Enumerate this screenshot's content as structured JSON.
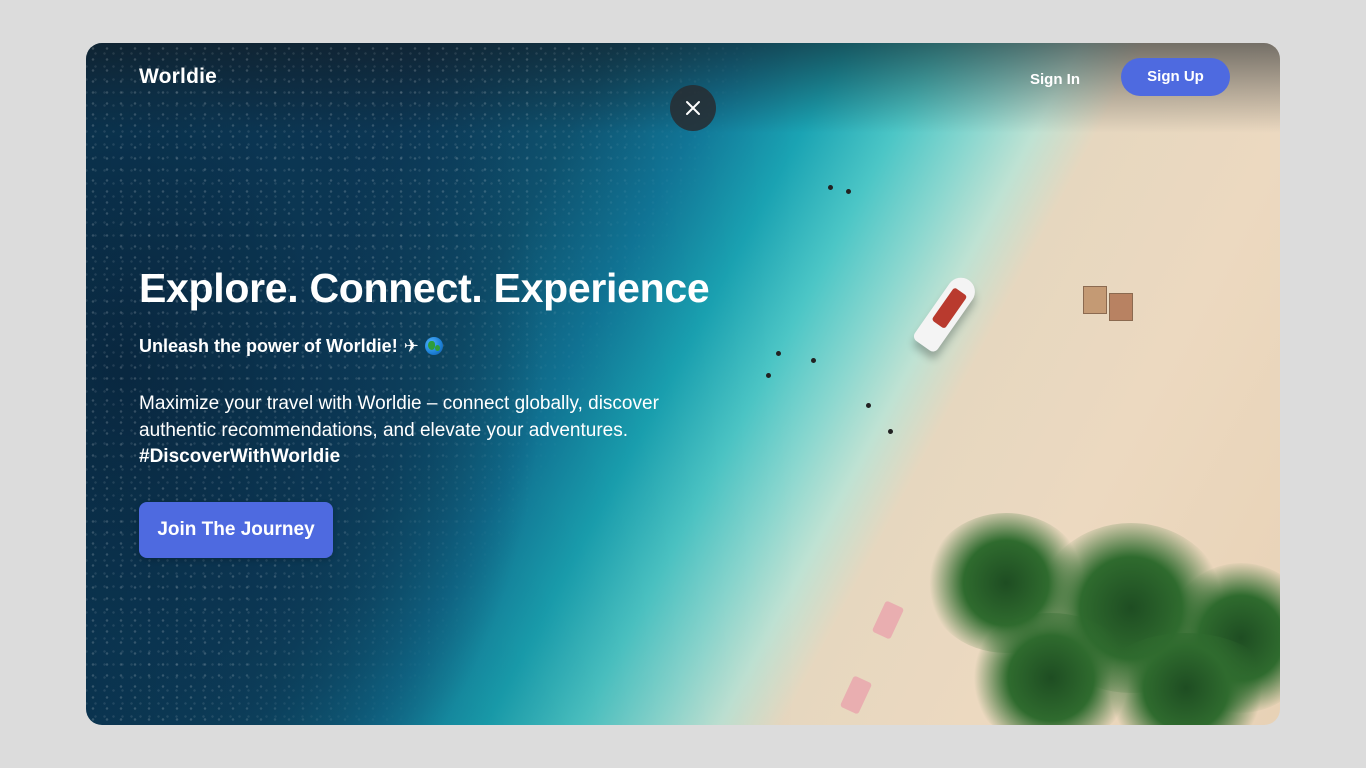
{
  "brand": {
    "name": "Worldie"
  },
  "header": {
    "signin_label": "Sign In",
    "signup_label": "Sign Up"
  },
  "close_icon": "close-icon",
  "hero": {
    "title": "Explore. Connect. Experience",
    "subtitle": "Unleash the power of Worldie!",
    "subtitle_plane": "✈",
    "subtitle_globe_icon": "globe-emoji-icon",
    "description": "Maximize your travel with Worldie – connect globally, discover authentic recommendations, and elevate your adventures.",
    "hashtag": "#DiscoverWithWorldie",
    "cta_label": "Join The Journey"
  },
  "colors": {
    "accent": "#4e6ae0",
    "page_background": "#dcdcdc",
    "close_button_bg": "#2c3034",
    "text": "#ffffff"
  }
}
